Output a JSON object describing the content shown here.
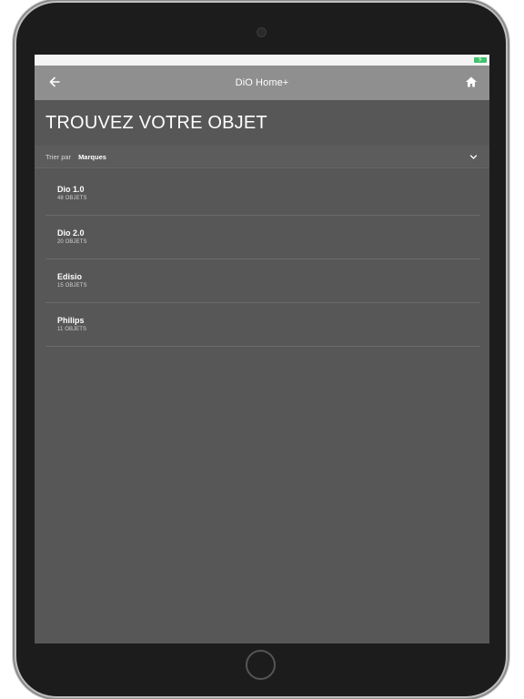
{
  "header": {
    "title": "DiO Home+"
  },
  "page": {
    "title": "TROUVEZ VOTRE OBJET"
  },
  "sort": {
    "label": "Trier par",
    "value": "Marques"
  },
  "items": [
    {
      "name": "Dio 1.0",
      "count": "48 OBJETS"
    },
    {
      "name": "Dio 2.0",
      "count": "20 OBJETS"
    },
    {
      "name": "Edisio",
      "count": "15 OBJETS"
    },
    {
      "name": "Philips",
      "count": "11 OBJETS"
    }
  ],
  "icons": {
    "back": "back-arrow-icon",
    "home": "home-icon",
    "sort": "chevron-down-icon",
    "battery": "battery-charging-icon"
  },
  "colors": {
    "header_bg": "#8f8f8f",
    "screen_bg": "#575757",
    "battery": "#3ec46d"
  }
}
